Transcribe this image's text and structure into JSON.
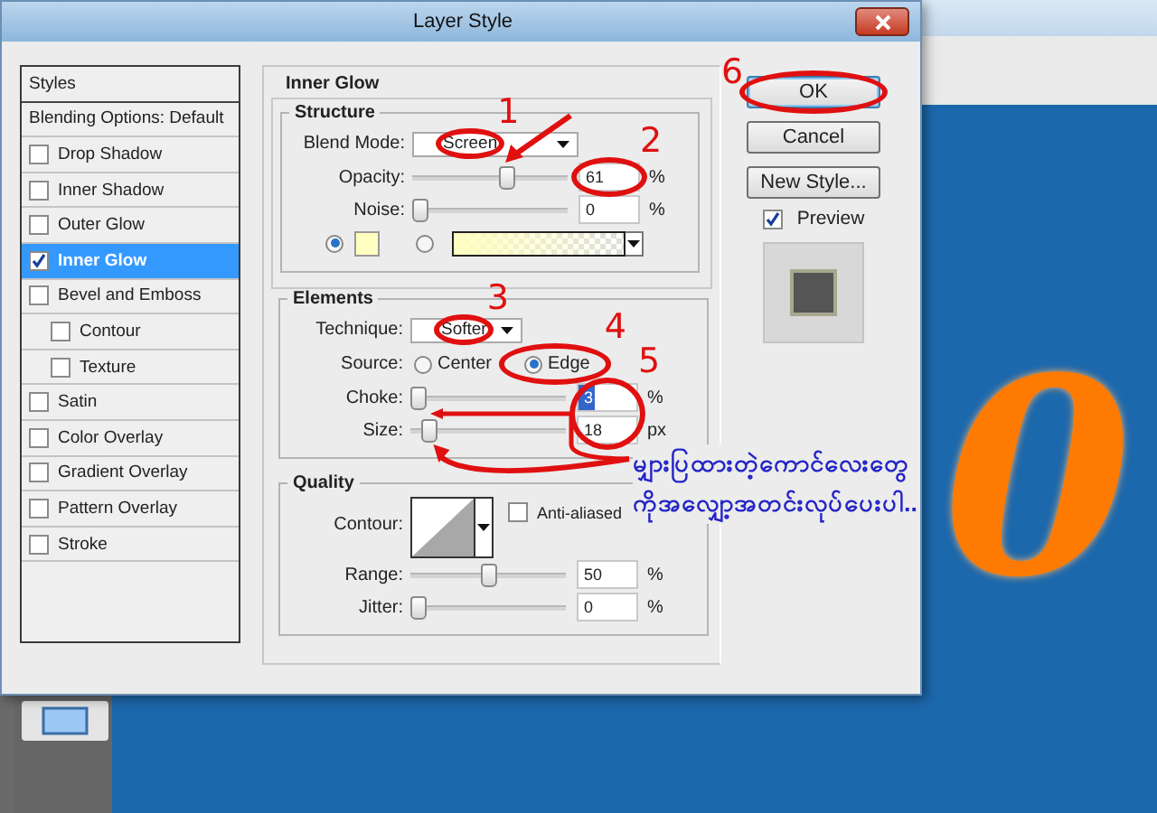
{
  "window": {
    "title": "Layer Style"
  },
  "styles_list": {
    "header": "Styles",
    "items": [
      {
        "label": "Blending Options: Default",
        "kind": "plain",
        "selected": false
      },
      {
        "label": "Drop Shadow",
        "kind": "check",
        "checked": false,
        "selected": false
      },
      {
        "label": "Inner Shadow",
        "kind": "check",
        "checked": false,
        "selected": false
      },
      {
        "label": "Outer Glow",
        "kind": "check",
        "checked": false,
        "selected": false
      },
      {
        "label": "Inner Glow",
        "kind": "check",
        "checked": true,
        "selected": true
      },
      {
        "label": "Bevel and Emboss",
        "kind": "check",
        "checked": false,
        "selected": false,
        "children": [
          {
            "label": "Contour",
            "kind": "check",
            "checked": false,
            "selected": false
          },
          {
            "label": "Texture",
            "kind": "check",
            "checked": false,
            "selected": false
          }
        ]
      },
      {
        "label": "Satin",
        "kind": "check",
        "checked": false,
        "selected": false
      },
      {
        "label": "Color Overlay",
        "kind": "check",
        "checked": false,
        "selected": false
      },
      {
        "label": "Gradient Overlay",
        "kind": "check",
        "checked": false,
        "selected": false
      },
      {
        "label": "Pattern Overlay",
        "kind": "check",
        "checked": false,
        "selected": false
      },
      {
        "label": "Stroke",
        "kind": "check",
        "checked": false,
        "selected": false
      }
    ]
  },
  "inner_glow": {
    "title": "Inner Glow",
    "structure": {
      "title": "Structure",
      "blend_mode": {
        "label": "Blend Mode:",
        "value": "Screen"
      },
      "sliders": [
        {
          "label": "Opacity:",
          "level": 0.61,
          "value": "61",
          "unit": "%",
          "highlighted": false
        },
        {
          "label": "Noise:",
          "level": 0,
          "value": "0",
          "unit": "%",
          "highlighted": false
        }
      ],
      "fill_options": [
        {
          "kind": "color",
          "selected": true
        },
        {
          "kind": "gradient",
          "selected": false
        }
      ]
    },
    "elements": {
      "title": "Elements",
      "technique": {
        "label": "Technique:",
        "value": "Softer"
      },
      "source": {
        "label": "Source:",
        "options": [
          {
            "label": "Center",
            "selected": false
          },
          {
            "label": "Edge",
            "selected": true
          }
        ]
      },
      "sliders": [
        {
          "label": "Choke:",
          "level": 0,
          "value": "3",
          "unit": "%",
          "highlighted": true
        },
        {
          "label": "Size:",
          "level": 0.08,
          "value": "18",
          "unit": "px",
          "highlighted": false
        }
      ]
    },
    "quality": {
      "title": "Quality",
      "contour_label": "Contour:",
      "anti_aliased": {
        "label": "Anti-aliased",
        "checked": false
      },
      "sliders": [
        {
          "label": "Range:",
          "level": 0.5,
          "value": "50",
          "unit": "%",
          "highlighted": false
        },
        {
          "label": "Jitter:",
          "level": 0,
          "value": "0",
          "unit": "%",
          "highlighted": false
        }
      ]
    }
  },
  "buttons": [
    {
      "label": "OK",
      "default": true
    },
    {
      "label": "Cancel",
      "default": false
    },
    {
      "label": "New Style...",
      "default": false
    }
  ],
  "preview": {
    "label": "Preview",
    "checked": true
  },
  "canvas_text": "0",
  "annotations": {
    "numbers": [
      "1",
      "2",
      "3",
      "4",
      "5",
      "6"
    ],
    "message": [
      "မျှားပြထားတဲ့ကောင်လေးတွေ",
      "ကိုအလျှော့အတင်းလုပ်ပေးပါ.."
    ]
  }
}
